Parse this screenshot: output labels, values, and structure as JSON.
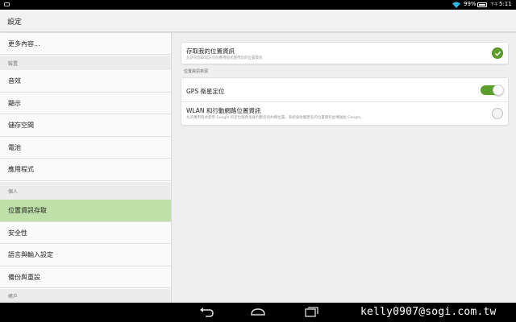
{
  "status_bar": {
    "battery_percent": "99%",
    "ampm": "下午",
    "time": "5:11"
  },
  "app_title": "設定",
  "sidebar": {
    "items": [
      {
        "type": "item",
        "label": "更多內容..."
      },
      {
        "type": "header",
        "label": "裝置"
      },
      {
        "type": "item",
        "label": "音效"
      },
      {
        "type": "item",
        "label": "顯示"
      },
      {
        "type": "item",
        "label": "儲存空間"
      },
      {
        "type": "item",
        "label": "電池"
      },
      {
        "type": "item",
        "label": "應用程式"
      },
      {
        "type": "header",
        "label": "個人"
      },
      {
        "type": "item",
        "label": "位置資訊存取",
        "selected": true
      },
      {
        "type": "item",
        "label": "安全性"
      },
      {
        "type": "item",
        "label": "語言與輸入設定"
      },
      {
        "type": "item",
        "label": "備份與重設"
      },
      {
        "type": "header",
        "label": "帳戶"
      }
    ]
  },
  "main": {
    "access_location": {
      "title": "存取我的位置資訊",
      "summary": "允許向您取得許可的應用程式使用您的位置資訊",
      "checked": true
    },
    "section_label": "位置資訊來源",
    "gps": {
      "title": "GPS 衛星定位",
      "enabled": true
    },
    "wlan": {
      "title": "WLAN 和行動網路位置資訊",
      "summary": "允許應用程式使用 Google 的定位服務加速判斷您的約略位置。系統會收集匿名的位置資料並傳送給 Google。",
      "checked": false
    }
  },
  "colors": {
    "accent": "#5b9e2b",
    "selected_item_bg": "#bfe0a8"
  },
  "watermark": "kelly0907@sogi.com.tw"
}
